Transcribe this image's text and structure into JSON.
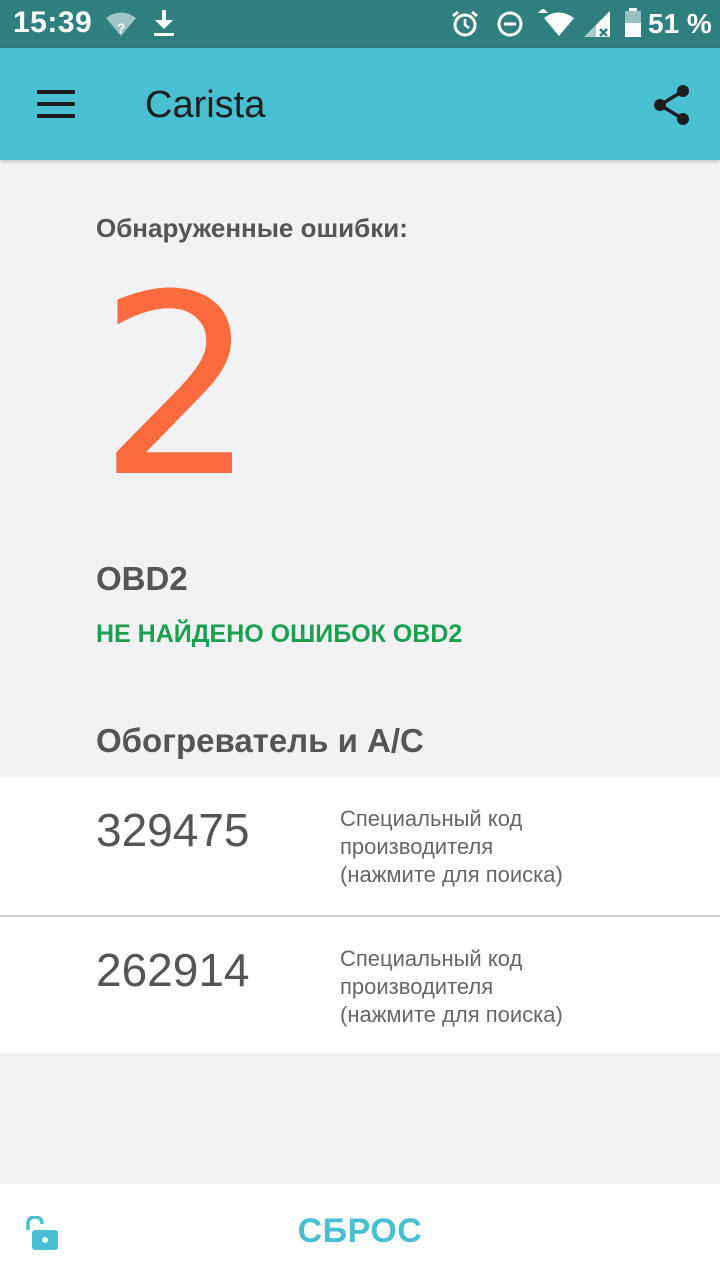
{
  "status_bar": {
    "time": "15:39",
    "battery_percent": "51 %",
    "icons": [
      "wifi-question-icon",
      "download-icon",
      "alarm-icon",
      "do-not-disturb-icon",
      "wifi-icon",
      "signal-icon",
      "battery-icon"
    ]
  },
  "app_bar": {
    "title": "Carista",
    "menu_icon": "hamburger-menu-icon",
    "share_icon": "share-icon",
    "color": "#48c0d1"
  },
  "summary": {
    "label": "Обнаруженные ошибки:",
    "count": "2",
    "count_color": "#fb6b3d"
  },
  "obd": {
    "heading": "OBD2",
    "status": "НЕ НАЙДЕНО ОШИБОК OBD2",
    "status_color": "#1aa04e"
  },
  "heater_ac": {
    "heading": "Обогреватель и A/C",
    "codes": [
      {
        "code": "329475",
        "line1": "Специальный код",
        "line2": "производителя",
        "line3": "(нажмите для поиска)"
      },
      {
        "code": "262914",
        "line1": "Специальный код",
        "line2": "производителя",
        "line3": "(нажмите для поиска)"
      }
    ]
  },
  "bottom_bar": {
    "lock_icon": "unlock-icon",
    "reset_label": "СБРОС"
  }
}
